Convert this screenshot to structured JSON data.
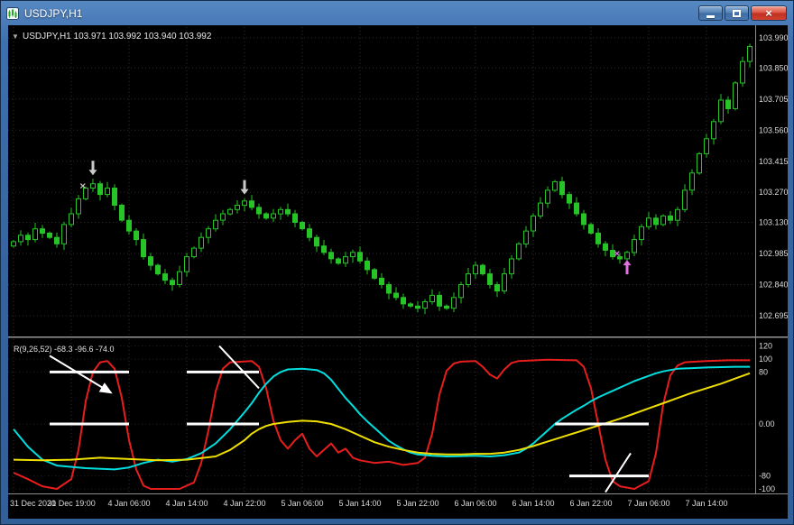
{
  "window": {
    "title": "USDJPY,H1",
    "controls": {
      "minimize_label": "Minimize",
      "maximize_label": "Maximize",
      "close_label": "Close",
      "close_glyph": "×"
    }
  },
  "chart_data": {
    "type": "candlestick",
    "symbol": "USDJPY",
    "timeframe": "H1",
    "header_text": "USDJPY,H1  103.971 103.992 103.940 103.992",
    "dropdown_glyph": "▼",
    "colors": {
      "background": "#000000",
      "grid": "#2e2e2e",
      "grid_levels": "#232323",
      "candle": "#27c427",
      "axis_text": "#dcdcdc",
      "divider": "#9a9a9a",
      "red_line": "#e81e1e",
      "cyan_line": "#00dede",
      "yellow_line": "#efdf00",
      "white_objects": "#ffffff",
      "arrow_gray": "#c9c9c9",
      "arrow_violet": "#df73df"
    },
    "price_axis_labels": [
      103.99,
      103.85,
      103.705,
      103.56,
      103.415,
      103.27,
      103.13,
      102.985,
      102.84,
      102.695
    ],
    "time_axis_labels": [
      "31 Dec 2020",
      "31 Dec 19:00",
      "4 Jan 06:00",
      "4 Jan 14:00",
      "4 Jan 22:00",
      "5 Jan 06:00",
      "5 Jan 14:00",
      "5 Jan 22:00",
      "6 Jan 06:00",
      "6 Jan 14:00",
      "6 Jan 22:00",
      "7 Jan 06:00",
      "7 Jan 14:00"
    ],
    "bars_per_label": 8,
    "first_open": 103.02,
    "closes": [
      103.04,
      103.07,
      103.05,
      103.1,
      103.08,
      103.06,
      103.03,
      103.12,
      103.17,
      103.24,
      103.29,
      103.31,
      103.26,
      103.29,
      103.21,
      103.14,
      103.09,
      103.05,
      102.97,
      102.93,
      102.89,
      102.86,
      102.84,
      102.9,
      102.97,
      103.01,
      103.06,
      103.1,
      103.14,
      103.17,
      103.19,
      103.21,
      103.23,
      103.2,
      103.17,
      103.15,
      103.17,
      103.19,
      103.17,
      103.13,
      103.1,
      103.06,
      103.02,
      102.99,
      102.96,
      102.94,
      102.97,
      102.99,
      102.95,
      102.91,
      102.87,
      102.84,
      102.8,
      102.78,
      102.75,
      102.74,
      102.73,
      102.76,
      102.79,
      102.74,
      102.73,
      102.78,
      102.84,
      102.89,
      102.93,
      102.89,
      102.84,
      102.81,
      102.89,
      102.96,
      103.03,
      103.09,
      103.16,
      103.22,
      103.28,
      103.32,
      103.26,
      103.22,
      103.17,
      103.12,
      103.08,
      103.03,
      103.0,
      102.97,
      102.96,
      102.99,
      103.05,
      103.11,
      103.15,
      103.12,
      103.16,
      103.14,
      103.19,
      103.28,
      103.36,
      103.45,
      103.52,
      103.6,
      103.7,
      103.66,
      103.78,
      103.88,
      103.95
    ],
    "indicator": {
      "label": "R(9,26,52)",
      "values_text": "-68.3 -96.6 -74.0",
      "scale": [
        {
          "v": 120,
          "label": "120"
        },
        {
          "v": 100,
          "label": "100"
        },
        {
          "v": 80,
          "label": "80"
        },
        {
          "v": 0,
          "label": "0.00"
        },
        {
          "v": -80,
          "label": "-80"
        },
        {
          "v": -100,
          "label": "-100"
        }
      ],
      "series": [
        {
          "name": "fast-red",
          "color": "#e81e1e",
          "points": [
            [
              0,
              -75
            ],
            [
              2,
              -85
            ],
            [
              4,
              -96
            ],
            [
              6,
              -100
            ],
            [
              8,
              -85
            ],
            [
              9,
              -40
            ],
            [
              10,
              35
            ],
            [
              11,
              80
            ],
            [
              12,
              95
            ],
            [
              13,
              97
            ],
            [
              14,
              85
            ],
            [
              15,
              40
            ],
            [
              16,
              -25
            ],
            [
              17,
              -70
            ],
            [
              18,
              -95
            ],
            [
              19,
              -100
            ],
            [
              23,
              -100
            ],
            [
              25,
              -90
            ],
            [
              26,
              -60
            ],
            [
              27,
              -10
            ],
            [
              28,
              50
            ],
            [
              29,
              85
            ],
            [
              30,
              95
            ],
            [
              33,
              97
            ],
            [
              34,
              88
            ],
            [
              35,
              55
            ],
            [
              36,
              5
            ],
            [
              37,
              -25
            ],
            [
              38,
              -38
            ],
            [
              39,
              -25
            ],
            [
              40,
              -15
            ],
            [
              41,
              -38
            ],
            [
              42,
              -50
            ],
            [
              43,
              -40
            ],
            [
              44,
              -30
            ],
            [
              45,
              -44
            ],
            [
              46,
              -38
            ],
            [
              47,
              -52
            ],
            [
              48,
              -56
            ],
            [
              50,
              -60
            ],
            [
              52,
              -58
            ],
            [
              54,
              -63
            ],
            [
              56,
              -60
            ],
            [
              57,
              -52
            ],
            [
              58,
              -15
            ],
            [
              59,
              45
            ],
            [
              60,
              82
            ],
            [
              61,
              93
            ],
            [
              62,
              96
            ],
            [
              64,
              97
            ],
            [
              65,
              88
            ],
            [
              66,
              76
            ],
            [
              67,
              70
            ],
            [
              68,
              84
            ],
            [
              69,
              94
            ],
            [
              70,
              97
            ],
            [
              74,
              99
            ],
            [
              78,
              98
            ],
            [
              79,
              88
            ],
            [
              80,
              55
            ],
            [
              81,
              0
            ],
            [
              82,
              -55
            ],
            [
              83,
              -88
            ],
            [
              84,
              -96
            ],
            [
              86,
              -100
            ],
            [
              88,
              -88
            ],
            [
              89,
              -45
            ],
            [
              90,
              30
            ],
            [
              91,
              75
            ],
            [
              92,
              90
            ],
            [
              93,
              95
            ],
            [
              96,
              97
            ],
            [
              99,
              98
            ],
            [
              102,
              98
            ]
          ]
        },
        {
          "name": "medium-cyan",
          "color": "#00dede",
          "points": [
            [
              0,
              -8
            ],
            [
              2,
              -35
            ],
            [
              4,
              -55
            ],
            [
              6,
              -64
            ],
            [
              10,
              -68
            ],
            [
              14,
              -70
            ],
            [
              16,
              -67
            ],
            [
              18,
              -60
            ],
            [
              20,
              -55
            ],
            [
              22,
              -58
            ],
            [
              24,
              -54
            ],
            [
              26,
              -45
            ],
            [
              28,
              -30
            ],
            [
              30,
              -8
            ],
            [
              32,
              18
            ],
            [
              33,
              32
            ],
            [
              34,
              48
            ],
            [
              35,
              62
            ],
            [
              36,
              73
            ],
            [
              37,
              80
            ],
            [
              38,
              84
            ],
            [
              40,
              85
            ],
            [
              42,
              83
            ],
            [
              43,
              78
            ],
            [
              44,
              68
            ],
            [
              45,
              54
            ],
            [
              46,
              40
            ],
            [
              47,
              28
            ],
            [
              48,
              15
            ],
            [
              49,
              4
            ],
            [
              50,
              -6
            ],
            [
              51,
              -16
            ],
            [
              52,
              -26
            ],
            [
              53,
              -33
            ],
            [
              54,
              -39
            ],
            [
              55,
              -44
            ],
            [
              56,
              -47
            ],
            [
              58,
              -49
            ],
            [
              60,
              -50
            ],
            [
              64,
              -49
            ],
            [
              66,
              -50
            ],
            [
              68,
              -48
            ],
            [
              70,
              -44
            ],
            [
              71,
              -38
            ],
            [
              72,
              -30
            ],
            [
              73,
              -20
            ],
            [
              74,
              -10
            ],
            [
              75,
              0
            ],
            [
              76,
              8
            ],
            [
              77,
              15
            ],
            [
              78,
              22
            ],
            [
              79,
              28
            ],
            [
              80,
              35
            ],
            [
              81,
              41
            ],
            [
              82,
              46
            ],
            [
              83,
              51
            ],
            [
              84,
              56
            ],
            [
              85,
              61
            ],
            [
              86,
              66
            ],
            [
              87,
              70
            ],
            [
              88,
              74
            ],
            [
              89,
              78
            ],
            [
              90,
              81
            ],
            [
              91,
              83
            ],
            [
              92,
              85
            ],
            [
              94,
              86
            ],
            [
              96,
              87
            ],
            [
              100,
              88
            ],
            [
              102,
              88
            ]
          ]
        },
        {
          "name": "slow-yellow",
          "color": "#efdf00",
          "points": [
            [
              0,
              -55
            ],
            [
              4,
              -56
            ],
            [
              8,
              -55
            ],
            [
              12,
              -52
            ],
            [
              16,
              -54
            ],
            [
              20,
              -56
            ],
            [
              24,
              -55
            ],
            [
              28,
              -50
            ],
            [
              30,
              -40
            ],
            [
              32,
              -25
            ],
            [
              33,
              -15
            ],
            [
              34,
              -8
            ],
            [
              35,
              -3
            ],
            [
              36,
              0
            ],
            [
              38,
              3
            ],
            [
              40,
              5
            ],
            [
              42,
              4
            ],
            [
              44,
              0
            ],
            [
              46,
              -8
            ],
            [
              48,
              -18
            ],
            [
              50,
              -28
            ],
            [
              52,
              -35
            ],
            [
              54,
              -40
            ],
            [
              56,
              -44
            ],
            [
              58,
              -46
            ],
            [
              60,
              -47
            ],
            [
              62,
              -47
            ],
            [
              64,
              -46
            ],
            [
              66,
              -46
            ],
            [
              68,
              -44
            ],
            [
              70,
              -40
            ],
            [
              72,
              -34
            ],
            [
              74,
              -27
            ],
            [
              76,
              -20
            ],
            [
              78,
              -13
            ],
            [
              80,
              -6
            ],
            [
              82,
              1
            ],
            [
              84,
              8
            ],
            [
              86,
              16
            ],
            [
              88,
              24
            ],
            [
              90,
              32
            ],
            [
              92,
              40
            ],
            [
              94,
              48
            ],
            [
              96,
              55
            ],
            [
              98,
              62
            ],
            [
              100,
              70
            ],
            [
              102,
              78
            ]
          ]
        }
      ]
    },
    "objects": {
      "arrows": [
        {
          "dir": "down",
          "bar": 11,
          "price": 103.35,
          "color": "#c9c9c9"
        },
        {
          "dir": "down",
          "bar": 32,
          "price": 103.26,
          "color": "#c9c9c9"
        },
        {
          "dir": "up",
          "bar": 85,
          "price": 102.955,
          "color": "#df73df"
        }
      ],
      "marks": [
        {
          "bar": 9.6,
          "price": 103.3,
          "color": "#c9c9c9"
        },
        {
          "bar": 83.6,
          "price": 102.985,
          "color": "#df73df"
        }
      ],
      "ind_hlines": [
        {
          "v": 80,
          "bar1": 5,
          "bar2": 16
        },
        {
          "v": 0,
          "bar1": 5,
          "bar2": 16
        },
        {
          "v": 80,
          "bar1": 24,
          "bar2": 34
        },
        {
          "v": 0,
          "bar1": 24,
          "bar2": 34
        },
        {
          "v": 0,
          "bar1": 75,
          "bar2": 88
        },
        {
          "v": -80,
          "bar1": 77,
          "bar2": 88
        }
      ],
      "ind_trendlines": [
        {
          "bar1": 5,
          "v1": 105,
          "bar2": 13.5,
          "v2": 48,
          "arrow": true
        },
        {
          "bar1": 28.5,
          "v1": 120,
          "bar2": 34,
          "v2": 55,
          "arrow": false
        },
        {
          "bar1": 82,
          "v1": -105,
          "bar2": 85.5,
          "v2": -45,
          "arrow": false
        }
      ]
    }
  }
}
